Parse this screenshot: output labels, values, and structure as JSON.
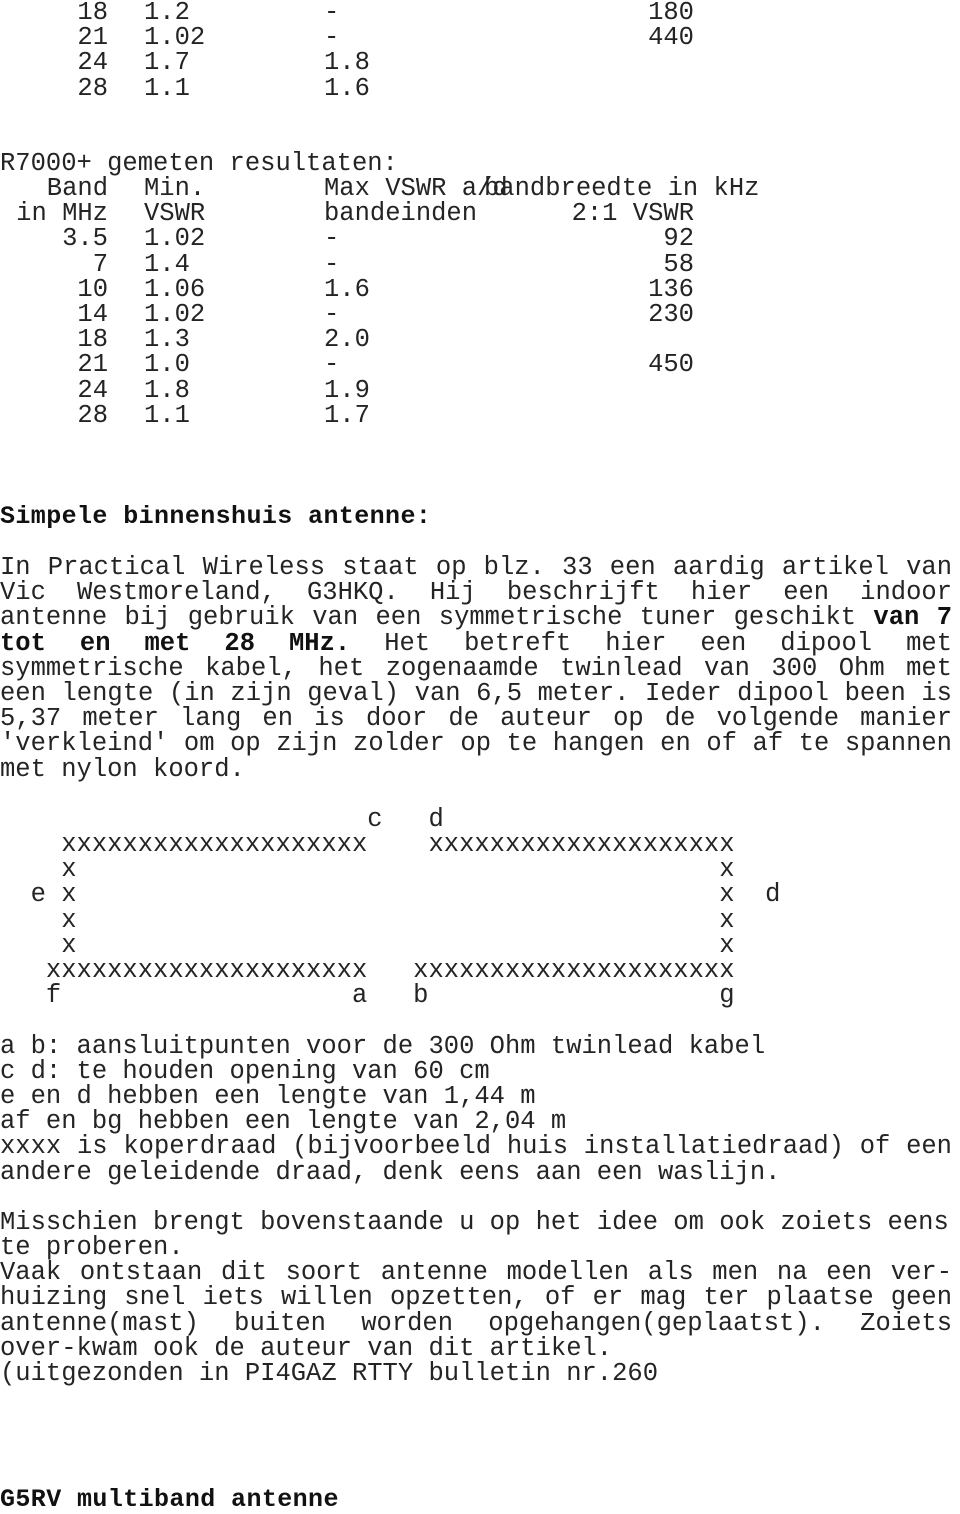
{
  "document": {
    "top_table_rows": [
      {
        "band": "18",
        "min_vswr": "1.2",
        "max_vswr": "-",
        "bandwidth": "180"
      },
      {
        "band": "21",
        "min_vswr": "1.02",
        "max_vswr": "-",
        "bandwidth": "440"
      },
      {
        "band": "24",
        "min_vswr": "1.7",
        "max_vswr": "1.8",
        "bandwidth": ""
      },
      {
        "band": "28",
        "min_vswr": "1.1",
        "max_vswr": "1.6",
        "bandwidth": ""
      }
    ],
    "r7000_title": "R7000+ gemeten resultaten:",
    "table_header": {
      "line1_col1": "Band",
      "line1_col2": "Min.",
      "line1_col3": "Max VSWR a/d",
      "line1_col4": "bandbreedte in kHz",
      "line2_col1": "in MHz",
      "line2_col2": "VSWR",
      "line2_col3": "bandeinden",
      "line2_col4": "2:1 VSWR"
    },
    "r7000_table_rows": [
      {
        "band": "3.5",
        "min_vswr": "1.02",
        "max_vswr": "-",
        "bandwidth": "92"
      },
      {
        "band": "7",
        "min_vswr": "1.4",
        "max_vswr": "-",
        "bandwidth": "58"
      },
      {
        "band": "10",
        "min_vswr": "1.06",
        "max_vswr": "1.6",
        "bandwidth": "136"
      },
      {
        "band": "14",
        "min_vswr": "1.02",
        "max_vswr": "-",
        "bandwidth": "230"
      },
      {
        "band": "18",
        "min_vswr": "1.3",
        "max_vswr": "2.0",
        "bandwidth": ""
      },
      {
        "band": "21",
        "min_vswr": "1.0",
        "max_vswr": "-",
        "bandwidth": "450"
      },
      {
        "band": "24",
        "min_vswr": "1.8",
        "max_vswr": "1.9",
        "bandwidth": ""
      },
      {
        "band": "28",
        "min_vswr": "1.1",
        "max_vswr": "1.7",
        "bandwidth": ""
      }
    ],
    "section_heading": "Simpele binnenshuis antenne:",
    "body_p1_part1": "In Practical Wireless staat op blz. 33 een aardig artikel van Vic Westmoreland, G3HKQ. Hij beschrijft hier een indoor antenne bij gebruik van een symmetrische tuner geschikt ",
    "body_p1_bold1": "van 7 tot en met 28 MHz.",
    "body_p1_part2": " Het betreft hier een dipool met symmetrische kabel, het zogenaamde twinlead van 300 Ohm met een lengte (in zijn geval) van 6,5 meter. Ieder dipool been is 5,37 meter lang en is door de auteur op de volgende manier 'verkleind' om op zijn zolder op te hangen en of af te spannen met nylon koord.",
    "diagram": {
      "line1": "                        c   d",
      "line2": "    xxxxxxxxxxxxxxxxxxxx    xxxxxxxxxxxxxxxxxxxx",
      "line3": "    x                                          x",
      "line4": "  e x                                          x  d",
      "line5": "    x                                          x",
      "line6": "    x                                          x",
      "line7": "   xxxxxxxxxxxxxxxxxxxxx   xxxxxxxxxxxxxxxxxxxxx",
      "line8": "   f                   a   b                   g"
    },
    "legend": [
      "a b: aansluitpunten voor de 300 Ohm twinlead kabel",
      "c d: te houden opening van 60 cm",
      "e en d hebben een lengte van 1,44 m",
      "af en bg hebben een lengte van 2,04 m"
    ],
    "legend_justified": "xxxx is koperdraad (bijvoorbeeld huis installatiedraad) of een andere geleidende draad, denk eens aan een waslijn.",
    "body_p2": "Misschien brengt bovenstaande u op het idee om ook zoiets eens te proberen.",
    "body_p3": "Vaak ontstaan dit soort antenne modellen als men na een ver-huizing snel iets willen opzetten, of er mag ter plaatse geen antenne(mast) buiten worden opgehangen(geplaatst). Zoiets over-kwam ook de auteur van dit artikel.",
    "body_p4": "(uitgezonden in PI4GAZ RTTY bulletin nr.260",
    "footer_heading": "G5RV multiband antenne"
  }
}
